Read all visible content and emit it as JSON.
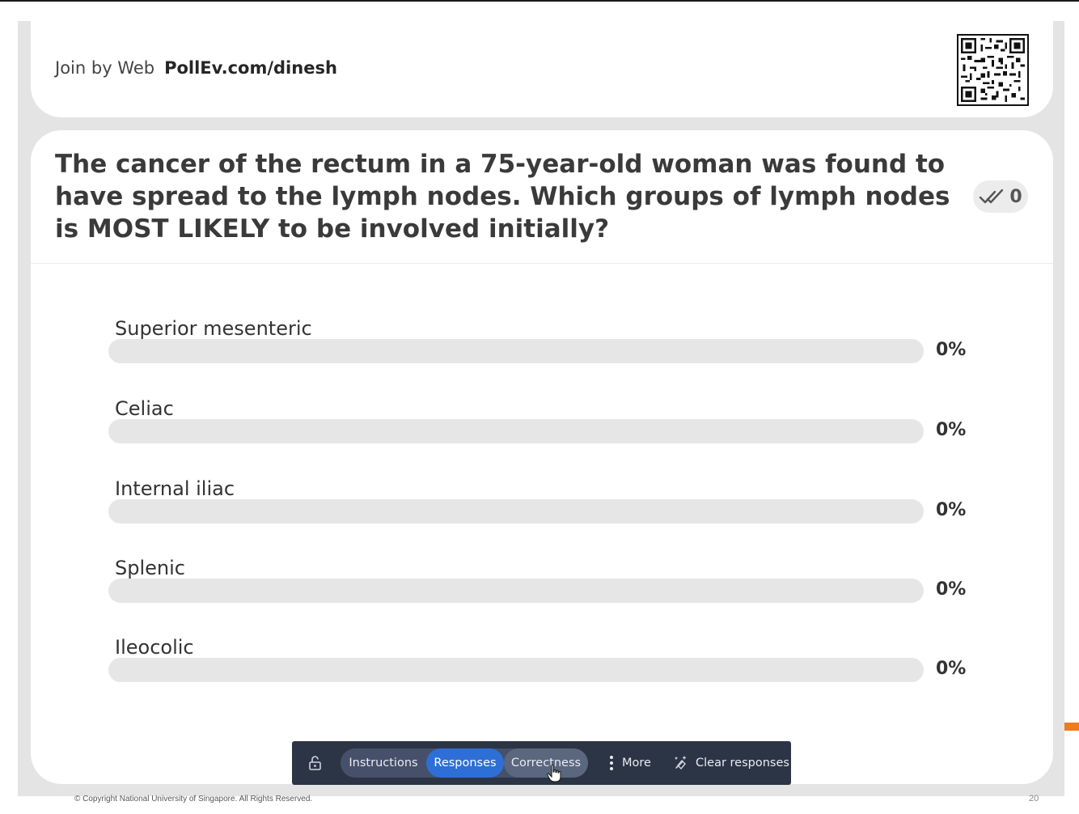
{
  "join": {
    "prefix": "Join by Web",
    "url": "PollEv.com/dinesh"
  },
  "question": {
    "text": "The cancer of the rectum in a 75-year-old woman was found to have spread to the lymph nodes. Which groups of lymph nodes is MOST LIKELY to be involved initially?",
    "response_count": "0"
  },
  "options": [
    {
      "label": "Superior mesenteric",
      "percent_text": "0%",
      "fraction": 0
    },
    {
      "label": "Celiac",
      "percent_text": "0%",
      "fraction": 0
    },
    {
      "label": "Internal iliac",
      "percent_text": "0%",
      "fraction": 0
    },
    {
      "label": "Splenic",
      "percent_text": "0%",
      "fraction": 0
    },
    {
      "label": "Ileocolic",
      "percent_text": "0%",
      "fraction": 0
    }
  ],
  "toolbar": {
    "instructions": "Instructions",
    "responses": "Responses",
    "correctness": "Correctness",
    "more": "More",
    "clear": "Clear responses",
    "active_tab": "Responses"
  },
  "footer": {
    "copyright": "© Copyright National University of Singapore. All Rights Reserved.",
    "page": "20"
  },
  "colors": {
    "accent": "#2d6fd6",
    "toolbar_bg": "#2c3545",
    "brand_orange": "#f07a1e"
  },
  "icons": [
    "lock-icon",
    "responses-check-icon",
    "more-vertical-icon",
    "clear-responses-icon",
    "qr-code-icon",
    "hand-cursor-icon"
  ]
}
